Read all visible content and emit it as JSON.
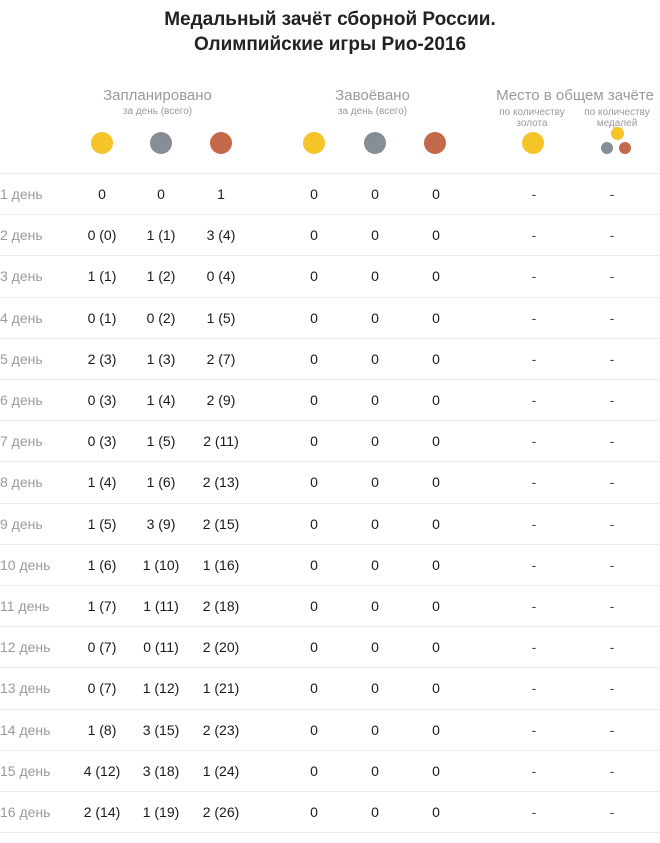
{
  "title": {
    "line1": "Медальный зачёт сборной России.",
    "line2": "Олимпийские игры Рио-2016"
  },
  "headers": {
    "planned": {
      "label": "Запланировано",
      "sub": "за день (всего)"
    },
    "won": {
      "label": "Завоёвано",
      "sub": "за день (всего)"
    },
    "place": {
      "label": "Место в общем зачёте",
      "by_gold": "по количеству золота",
      "by_medals": "по количеству медалей"
    }
  },
  "colors": {
    "gold": "#f5c428",
    "silver": "#868d95",
    "bronze": "#c4694a"
  },
  "rows": [
    {
      "day": "1 день",
      "p_gold": "0",
      "p_silver": "0",
      "p_bronze": "1",
      "w_gold": "0",
      "w_silver": "0",
      "w_bronze": "0",
      "place_gold": "-",
      "place_medals": "-"
    },
    {
      "day": "2 день",
      "p_gold": "0 (0)",
      "p_silver": "1 (1)",
      "p_bronze": "3 (4)",
      "w_gold": "0",
      "w_silver": "0",
      "w_bronze": "0",
      "place_gold": "-",
      "place_medals": "-"
    },
    {
      "day": "3 день",
      "p_gold": "1 (1)",
      "p_silver": "1 (2)",
      "p_bronze": "0 (4)",
      "w_gold": "0",
      "w_silver": "0",
      "w_bronze": "0",
      "place_gold": "-",
      "place_medals": "-"
    },
    {
      "day": "4 день",
      "p_gold": "0 (1)",
      "p_silver": "0 (2)",
      "p_bronze": "1 (5)",
      "w_gold": "0",
      "w_silver": "0",
      "w_bronze": "0",
      "place_gold": "-",
      "place_medals": "-"
    },
    {
      "day": "5 день",
      "p_gold": "2 (3)",
      "p_silver": "1 (3)",
      "p_bronze": "2 (7)",
      "w_gold": "0",
      "w_silver": "0",
      "w_bronze": "0",
      "place_gold": "-",
      "place_medals": "-"
    },
    {
      "day": "6 день",
      "p_gold": "0 (3)",
      "p_silver": "1 (4)",
      "p_bronze": "2 (9)",
      "w_gold": "0",
      "w_silver": "0",
      "w_bronze": "0",
      "place_gold": "-",
      "place_medals": "-"
    },
    {
      "day": "7 день",
      "p_gold": "0 (3)",
      "p_silver": "1 (5)",
      "p_bronze": "2 (11)",
      "w_gold": "0",
      "w_silver": "0",
      "w_bronze": "0",
      "place_gold": "-",
      "place_medals": "-"
    },
    {
      "day": "8 день",
      "p_gold": "1 (4)",
      "p_silver": "1 (6)",
      "p_bronze": "2 (13)",
      "w_gold": "0",
      "w_silver": "0",
      "w_bronze": "0",
      "place_gold": "-",
      "place_medals": "-"
    },
    {
      "day": "9 день",
      "p_gold": "1 (5)",
      "p_silver": "3 (9)",
      "p_bronze": "2 (15)",
      "w_gold": "0",
      "w_silver": "0",
      "w_bronze": "0",
      "place_gold": "-",
      "place_medals": "-"
    },
    {
      "day": "10 день",
      "p_gold": "1 (6)",
      "p_silver": "1 (10)",
      "p_bronze": "1 (16)",
      "w_gold": "0",
      "w_silver": "0",
      "w_bronze": "0",
      "place_gold": "-",
      "place_medals": "-"
    },
    {
      "day": "11 день",
      "p_gold": "1 (7)",
      "p_silver": "1 (11)",
      "p_bronze": "2 (18)",
      "w_gold": "0",
      "w_silver": "0",
      "w_bronze": "0",
      "place_gold": "-",
      "place_medals": "-"
    },
    {
      "day": "12 день",
      "p_gold": "0 (7)",
      "p_silver": "0 (11)",
      "p_bronze": "2 (20)",
      "w_gold": "0",
      "w_silver": "0",
      "w_bronze": "0",
      "place_gold": "-",
      "place_medals": "-"
    },
    {
      "day": "13 день",
      "p_gold": "0 (7)",
      "p_silver": "1 (12)",
      "p_bronze": "1 (21)",
      "w_gold": "0",
      "w_silver": "0",
      "w_bronze": "0",
      "place_gold": "-",
      "place_medals": "-"
    },
    {
      "day": "14 день",
      "p_gold": "1 (8)",
      "p_silver": "3 (15)",
      "p_bronze": "2 (23)",
      "w_gold": "0",
      "w_silver": "0",
      "w_bronze": "0",
      "place_gold": "-",
      "place_medals": "-"
    },
    {
      "day": "15 день",
      "p_gold": "4 (12)",
      "p_silver": "3 (18)",
      "p_bronze": "1 (24)",
      "w_gold": "0",
      "w_silver": "0",
      "w_bronze": "0",
      "place_gold": "-",
      "place_medals": "-"
    },
    {
      "day": "16 день",
      "p_gold": "2 (14)",
      "p_silver": "1 (19)",
      "p_bronze": "2 (26)",
      "w_gold": "0",
      "w_silver": "0",
      "w_bronze": "0",
      "place_gold": "-",
      "place_medals": "-"
    }
  ]
}
